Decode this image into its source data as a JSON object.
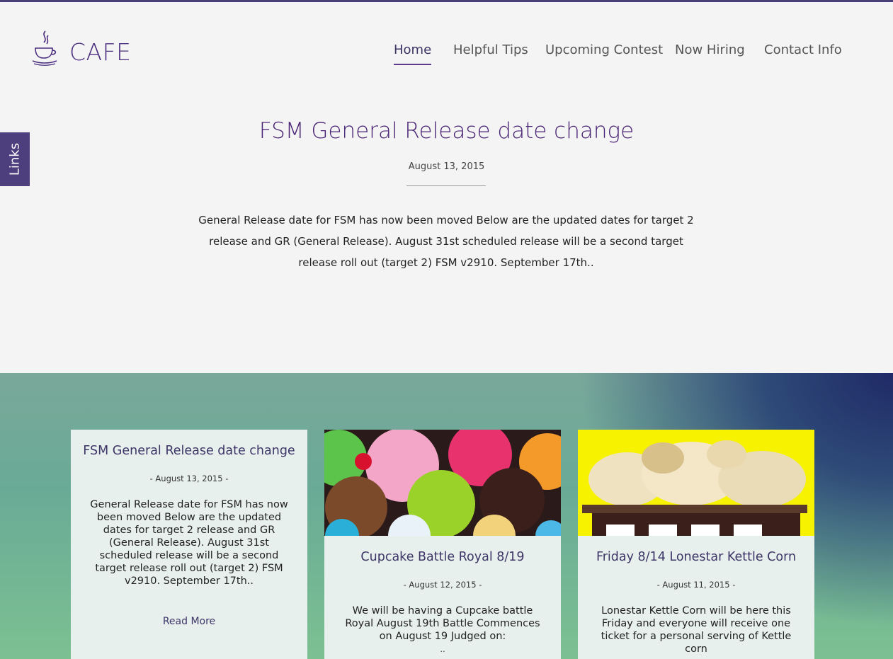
{
  "site": {
    "name": "CAFE",
    "logo_icon": "coffee-cup-icon"
  },
  "nav": {
    "items": [
      {
        "label": "Home",
        "active": true
      },
      {
        "label": "Helpful Tips"
      },
      {
        "label": "Upcoming Contest"
      },
      {
        "label": "Now Hiring"
      },
      {
        "label": "Contact Info"
      }
    ]
  },
  "side_tab": {
    "label": "Links"
  },
  "hero": {
    "title": "FSM General Release date change",
    "date": "August 13, 2015",
    "excerpt": "General Release date for FSM has now been moved Below are the updated dates for target 2 release and GR (General Release). August 31st scheduled release will be a second target release roll out (target 2) FSM v2910. September 17th.."
  },
  "posts": [
    {
      "title": "FSM General Release date change",
      "date": "- August 13, 2015 -",
      "excerpt": "General Release date for FSM has now been moved Below are the updated dates for target 2 release and GR (General Release). August 31st scheduled release will be a second target release roll out (target 2) FSM v2910. September 17th..",
      "read_more": "Read More"
    },
    {
      "title": "Cupcake Battle Royal 8/19",
      "date": "- August 12, 2015 -",
      "excerpt": "We will be having a Cupcake battle Royal August 19th Battle Commences on August 19 Judged on:",
      "image": "cupcakes-photo",
      "more_marker": ".."
    },
    {
      "title": "Friday 8/14 Lonestar Kettle Corn",
      "date": "- August 11, 2015 -",
      "excerpt": "Lonestar Kettle Corn will be here this Friday and everyone will receive one ticket for a personal serving of Kettle corn",
      "image": "kettle-corn-photo"
    }
  ],
  "colors": {
    "accent": "#4a2d7f",
    "side_tab": "#4d3e7e",
    "top_bar": "#4b3f7a"
  }
}
